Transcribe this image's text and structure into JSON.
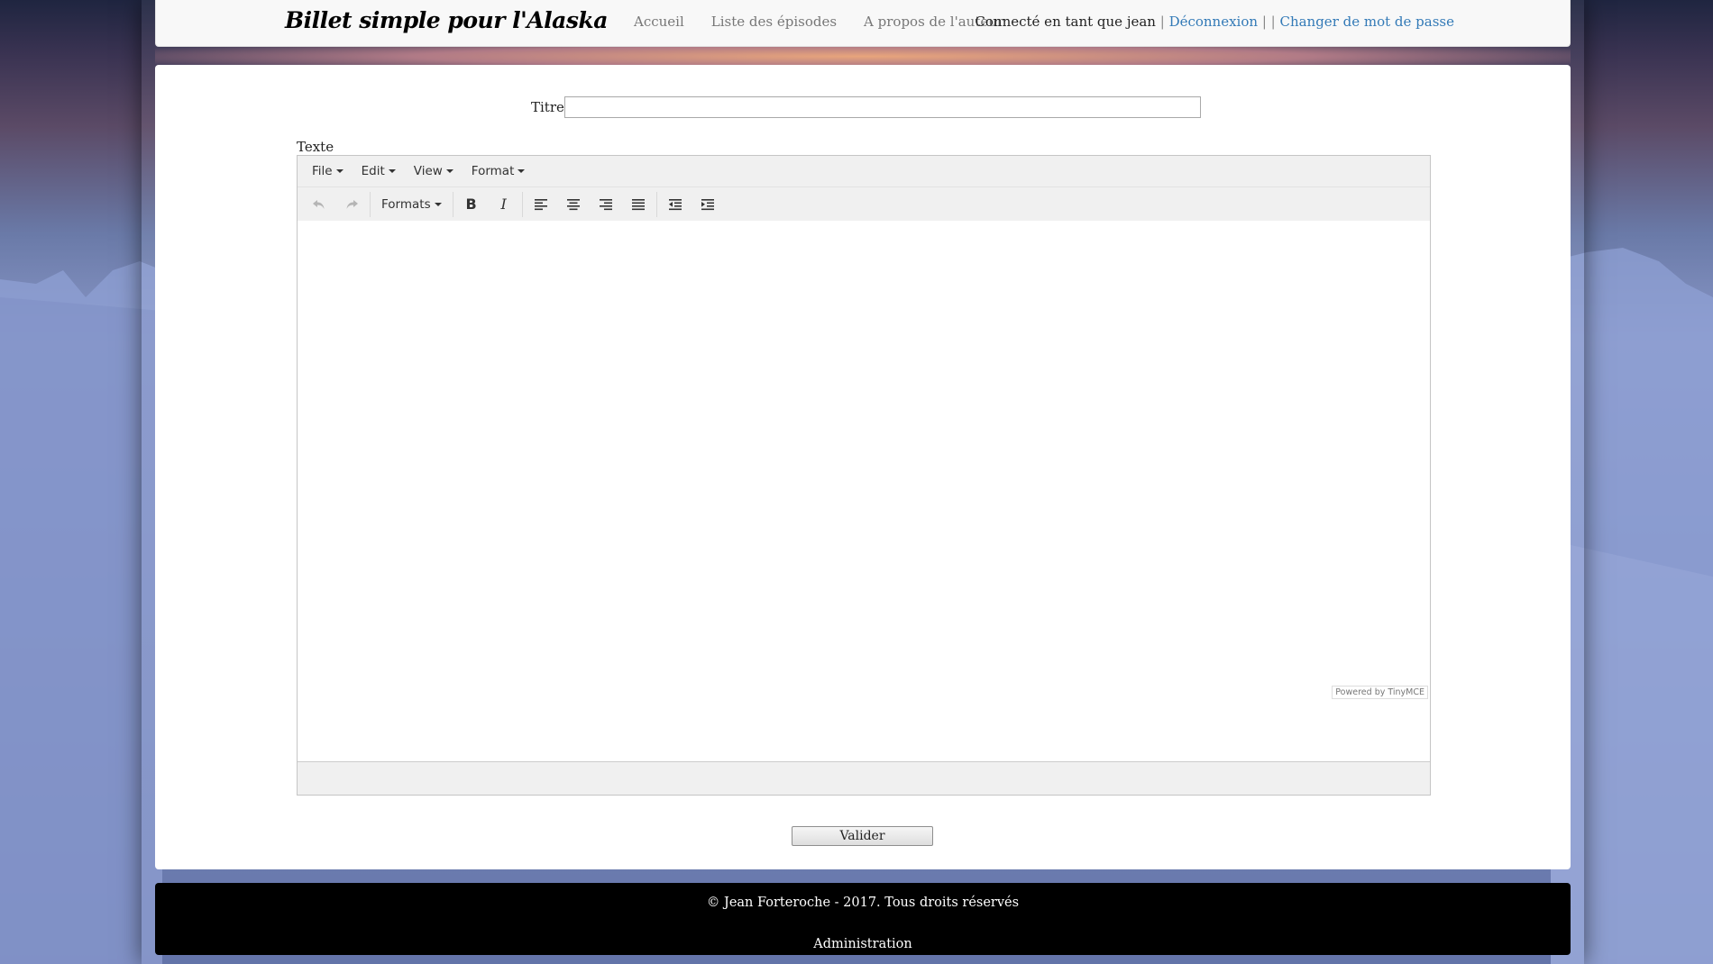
{
  "site": {
    "brand": "Billet simple pour l'Alaska"
  },
  "nav": {
    "items": [
      {
        "label": "Accueil"
      },
      {
        "label": "Liste des épisodes"
      },
      {
        "label": "A propos de l'auteur"
      }
    ]
  },
  "user": {
    "connected_text": "Connecté en tant que jean",
    "sep1": " | ",
    "logout": "Déconnexion",
    "sep2": " | | ",
    "change_password": "Changer de mot de passe"
  },
  "form": {
    "title_label": "Titre",
    "title_value": "",
    "text_label": "Texte",
    "submit_label": "Valider"
  },
  "editor": {
    "menus": [
      {
        "label": "File"
      },
      {
        "label": "Edit"
      },
      {
        "label": "View"
      },
      {
        "label": "Format"
      }
    ],
    "formats_label": "Formats",
    "powered_by": "Powered by TinyMCE",
    "toolbar_icons": [
      "undo-icon",
      "redo-icon",
      "bold-icon",
      "italic-icon",
      "align-left-icon",
      "align-center-icon",
      "align-right-icon",
      "align-justify-icon",
      "outdent-icon",
      "indent-icon"
    ]
  },
  "footer": {
    "copyright": "© Jean Forteroche - 2017. Tous droits réservés",
    "admin_link": "Administration"
  },
  "colors": {
    "link": "#337ab7",
    "footer_bg": "#000000",
    "header_bg": "#f8f8f8"
  }
}
